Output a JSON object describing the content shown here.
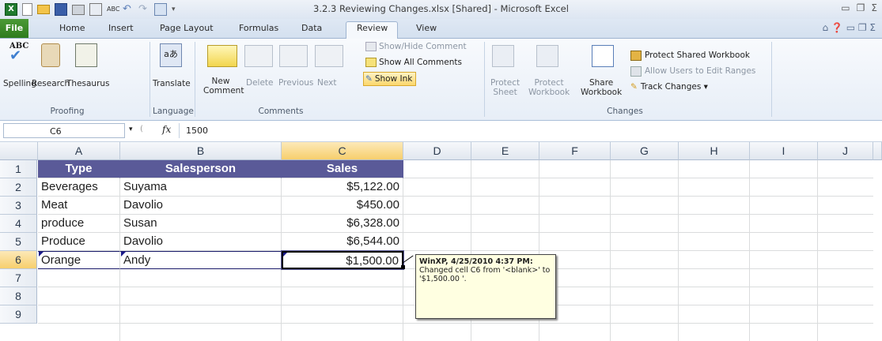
{
  "window": {
    "title": "3.2.3 Reviewing Changes.xlsx  [Shared]  -  Microsoft Excel",
    "qat_icons": [
      "excel-icon",
      "new-icon",
      "open-icon",
      "save-icon",
      "print-icon",
      "print-preview-icon",
      "spelling-icon",
      "undo-icon",
      "redo-icon",
      "form-icon"
    ],
    "controls": [
      "minimize",
      "restore",
      "close"
    ]
  },
  "tabs": [
    "File",
    "Home",
    "Insert",
    "Page Layout",
    "Formulas",
    "Data",
    "Review",
    "View"
  ],
  "active_tab": "Review",
  "ribbon": {
    "proofing": {
      "group": "Proofing",
      "spelling": "Spelling",
      "research": "Research",
      "thesaurus": "Thesaurus"
    },
    "language": {
      "group": "Language",
      "translate": "Translate"
    },
    "comments": {
      "group": "Comments",
      "new_comment_1": "New",
      "new_comment_2": "Comment",
      "delete": "Delete",
      "previous": "Previous",
      "next": "Next",
      "show_hide": "Show/Hide Comment",
      "show_all": "Show All Comments",
      "show_ink": "Show Ink"
    },
    "changes": {
      "group": "Changes",
      "protect_sheet_1": "Protect",
      "protect_sheet_2": "Sheet",
      "protect_workbook_1": "Protect",
      "protect_workbook_2": "Workbook",
      "share_workbook_1": "Share",
      "share_workbook_2": "Workbook",
      "protect_shared": "Protect Shared Workbook",
      "allow_users": "Allow Users to Edit Ranges",
      "track_changes": "Track Changes"
    }
  },
  "formula_bar": {
    "name_box": "C6",
    "fx": "fx",
    "value": "1500"
  },
  "columns": [
    "A",
    "B",
    "C",
    "D",
    "E",
    "F",
    "G",
    "H",
    "I",
    "J"
  ],
  "rows": [
    "1",
    "2",
    "3",
    "4",
    "5",
    "6",
    "7",
    "8",
    "9"
  ],
  "table": {
    "headers": [
      "Type",
      "Salesperson",
      "Sales"
    ],
    "rows": [
      [
        "Beverages",
        "Suyama",
        "$5,122.00"
      ],
      [
        "Meat",
        "Davolio",
        "$450.00"
      ],
      [
        "produce",
        "Susan",
        "$6,328.00"
      ],
      [
        "Produce",
        "Davolio",
        "$6,544.00"
      ],
      [
        "Orange",
        "Andy",
        "$1,500.00"
      ]
    ]
  },
  "comment": {
    "author": "WinXP, 4/25/2010 4:37 PM:",
    "text": "Changed cell C6 from '<blank>' to '$1,500.00 '."
  },
  "colors": {
    "header_fill": "#5a5a98",
    "selected_header": "#f7cf6d",
    "comment_bg": "#ffffe1"
  }
}
